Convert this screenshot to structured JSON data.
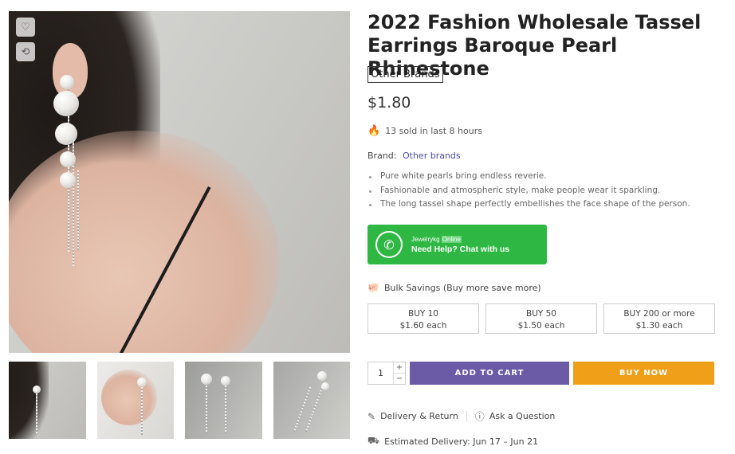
{
  "product": {
    "title": "2022 Fashion Wholesale Tassel Earrings Baroque Pearl Rhinestone",
    "brand_badge": "Other Brands",
    "price": "$1.80",
    "sold_text": "13 sold in last 8 hours",
    "brand_label": "Brand:",
    "brand_value": "Other brands",
    "features": [
      "Pure white pearls bring endless reverie.",
      "Fashionable and atmospheric style, make people wear it sparkling.",
      "The long tassel shape perfectly embellishes the face shape of the person."
    ]
  },
  "gallery": {
    "wishlist_icon": "heart-icon",
    "compare_icon": "refresh-icon",
    "thumbnails": 4
  },
  "whatsapp": {
    "name": "Jewelrykg",
    "status": "Online",
    "cta": "Need Help? Chat with us",
    "color": "#2eb843"
  },
  "bulk": {
    "label": "Bulk Savings (Buy more save more)",
    "tiers": [
      {
        "qty": "BUY 10",
        "price": "$1.60 each"
      },
      {
        "qty": "BUY 50",
        "price": "$1.50 each"
      },
      {
        "qty": "BUY 200 or more",
        "price": "$1.30 each"
      }
    ]
  },
  "purchase": {
    "quantity": "1",
    "plus": "+",
    "minus": "−",
    "add_to_cart": "ADD TO CART",
    "buy_now": "BUY NOW",
    "add_color": "#6b5aa6",
    "buy_color": "#f0a018"
  },
  "links": {
    "delivery_return": "Delivery & Return",
    "ask_question": "Ask a Question"
  },
  "delivery": {
    "estimated": "Estimated Delivery: Jun 17 – Jun 21"
  }
}
